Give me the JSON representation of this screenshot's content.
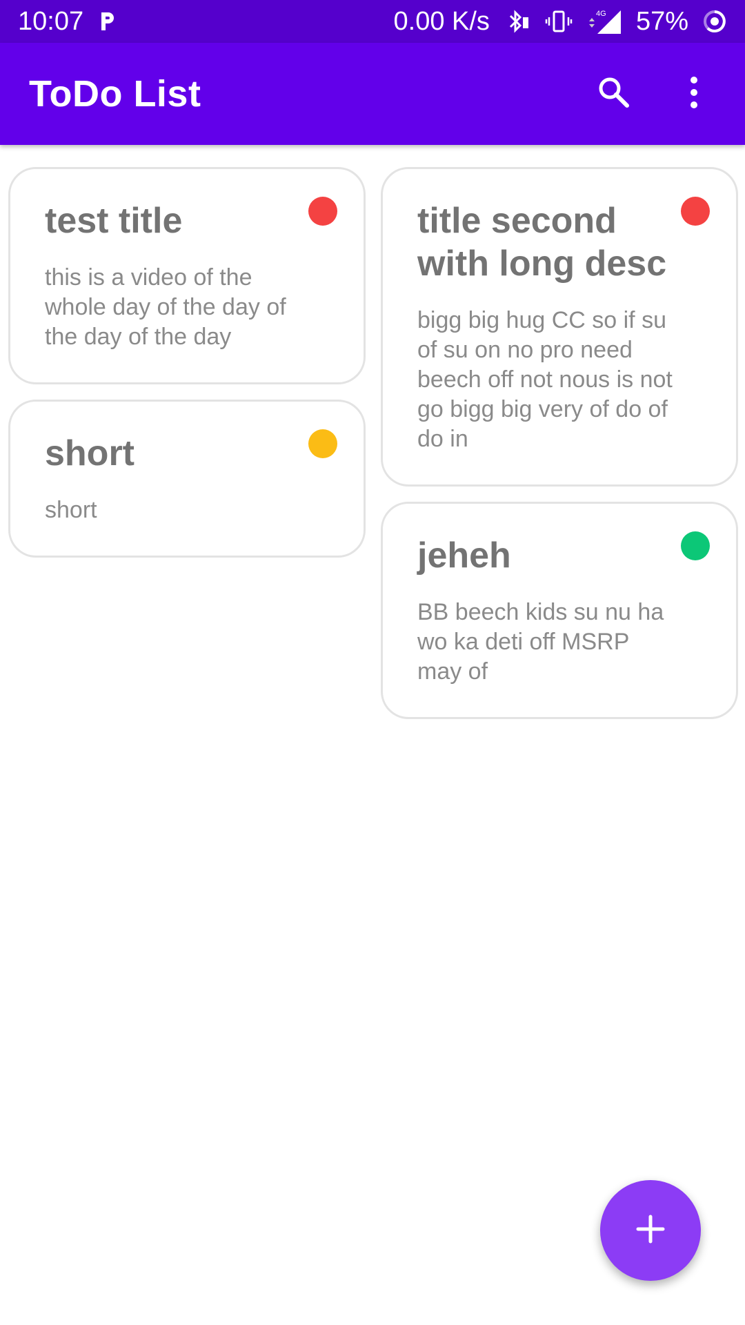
{
  "status_bar": {
    "time": "10:07",
    "network_speed": "0.00 K/s",
    "network_type": "4G",
    "battery": "57%",
    "background": "#5500cc"
  },
  "app_bar": {
    "title": "ToDo List",
    "background": "#6200ea",
    "icons": [
      "search-icon",
      "more-vert-icon"
    ]
  },
  "notes": {
    "left": [
      {
        "title": "test title",
        "description": "this is a video of the whole day of the day of the day of the day",
        "priority_color": "#f44242"
      },
      {
        "title": "short",
        "description": "short",
        "priority_color": "#fbbc15"
      }
    ],
    "right": [
      {
        "title": "title second with long desc",
        "description": "bigg big hug CC so if su of su on no pro need beech off not nous is not go bigg big very of do of do in",
        "priority_color": "#f44242"
      },
      {
        "title": "jeheh",
        "description": "BB beech kids su nu ha wo ka deti off MSRP may of",
        "priority_color": "#0cc777"
      }
    ]
  },
  "fab": {
    "icon": "add-icon",
    "color": "#8c3cf5"
  }
}
